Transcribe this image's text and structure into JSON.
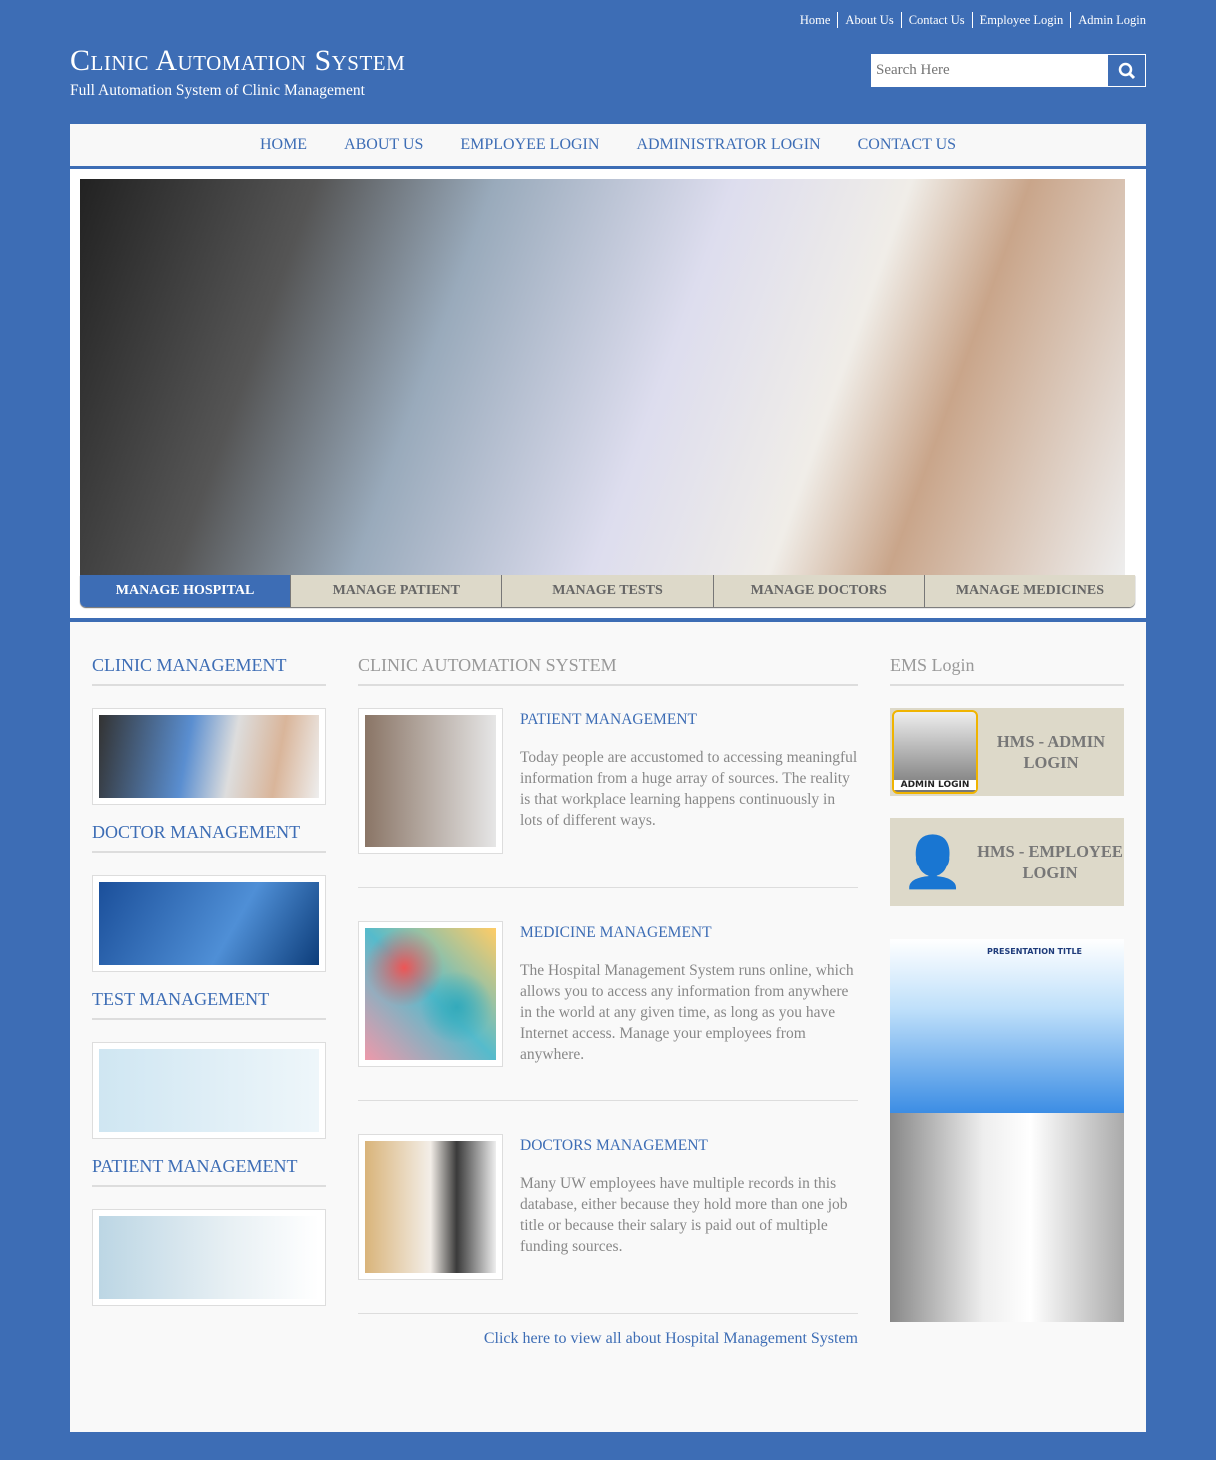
{
  "top_links": [
    "Home",
    "About Us",
    "Contact Us",
    "Employee Login",
    "Admin Login"
  ],
  "site": {
    "title": "Clinic Automation System",
    "subtitle": "Full Automation System of Clinic Management"
  },
  "search": {
    "placeholder": "Search Here",
    "icon": "search-icon"
  },
  "nav": [
    "HOME",
    "ABOUT US",
    "EMPLOYEE LOGIN",
    "ADMINISTRATOR LOGIN",
    "CONTACT US"
  ],
  "tabs": [
    "MANAGE HOSPITAL",
    "MANAGE PATIENT",
    "MANAGE TESTS",
    "MANAGE DOCTORS",
    "MANAGE MEDICINES"
  ],
  "left": {
    "headings": [
      "CLINIC MANAGEMENT",
      "DOCTOR MANAGEMENT",
      "TEST MANAGEMENT",
      "PATIENT MANAGEMENT"
    ]
  },
  "middle": {
    "heading": "CLINIC AUTOMATION SYSTEM",
    "articles": [
      {
        "title": "PATIENT MANAGEMENT",
        "text": "Today people are accustomed to accessing meaningful information from a huge array of sources. The reality is that workplace learning happens continuously in lots of different ways."
      },
      {
        "title": "MEDICINE MANAGEMENT",
        "text": "The Hospital Management System runs online, which allows you to access any information from anywhere in the world at any given time, as long as you have Internet access. Manage your employees from anywhere."
      },
      {
        "title": "DOCTORS MANAGEMENT",
        "text": "Many UW employees have multiple records in this database, either because they hold more than one job title or because their salary is paid out of multiple funding sources."
      }
    ],
    "link": "Click here to view all about Hospital Management System"
  },
  "right": {
    "heading": "EMS Login",
    "admin_login": "HMS - ADMIN LOGIN",
    "admin_badge": "ADMIN LOGIN",
    "employee_login": "HMS - EMPLOYEE LOGIN",
    "promo_title": "PRESENTATION TITLE"
  },
  "colors": {
    "brand": "#3d6db5",
    "tab_bg": "#ddd9c9"
  }
}
